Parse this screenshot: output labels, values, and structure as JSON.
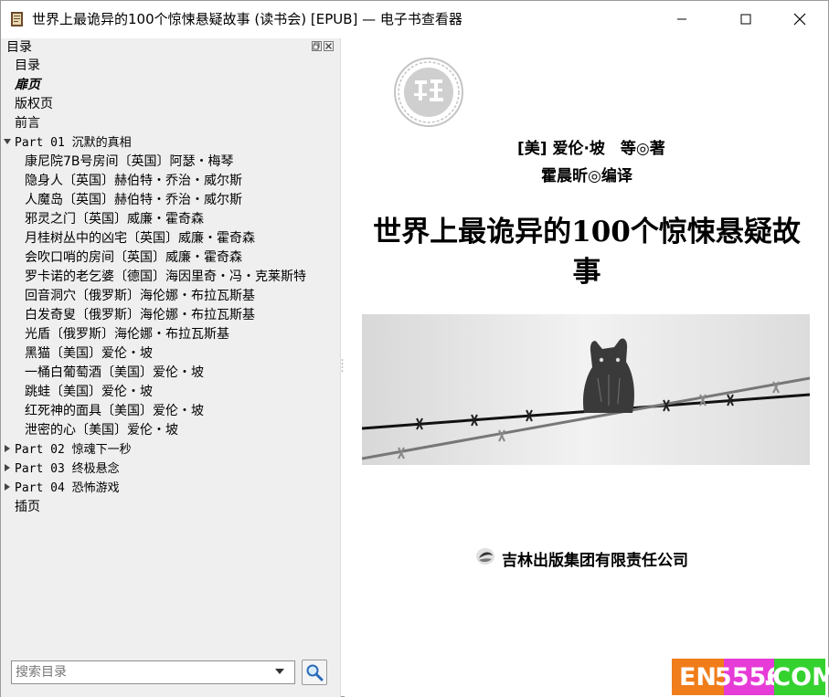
{
  "window": {
    "title": "世界上最诡异的100个惊悚悬疑故事 (读书会) [EPUB] — 电子书查看器"
  },
  "sidebar": {
    "dock_title": "目录",
    "toc": [
      {
        "label": "目录",
        "level": 0
      },
      {
        "label": "扉页",
        "level": 0,
        "style": "italic-bold"
      },
      {
        "label": "版权页",
        "level": 0
      },
      {
        "label": "前言",
        "level": 0
      },
      {
        "label": "Part 01 沉默的真相",
        "level": 0,
        "expanded": true
      },
      {
        "label": "康尼院7B号房间〔英国〕阿瑟・梅琴",
        "level": 1
      },
      {
        "label": "隐身人〔英国〕赫伯特・乔治・威尔斯",
        "level": 1
      },
      {
        "label": "人魔岛〔英国〕赫伯特・乔治・威尔斯",
        "level": 1
      },
      {
        "label": "邪灵之门〔英国〕威廉・霍奇森",
        "level": 1
      },
      {
        "label": "月桂树丛中的凶宅〔英国〕威廉・霍奇森",
        "level": 1
      },
      {
        "label": "会吹口哨的房间〔英国〕威廉・霍奇森",
        "level": 1
      },
      {
        "label": "罗卡诺的老乞婆〔德国〕海因里奇・冯・克莱斯特",
        "level": 1
      },
      {
        "label": "回音洞穴〔俄罗斯〕海伦娜・布拉瓦斯基",
        "level": 1
      },
      {
        "label": "白发奇叟〔俄罗斯〕海伦娜・布拉瓦斯基",
        "level": 1
      },
      {
        "label": "光盾〔俄罗斯〕海伦娜・布拉瓦斯基",
        "level": 1
      },
      {
        "label": "黑猫〔美国〕爱伦・坡",
        "level": 1
      },
      {
        "label": "一桶白葡萄酒〔美国〕爱伦・坡",
        "level": 1
      },
      {
        "label": "跳蛙〔美国〕爱伦・坡",
        "level": 1
      },
      {
        "label": "红死神的面具〔美国〕爱伦・坡",
        "level": 1
      },
      {
        "label": "泄密的心〔美国〕爱伦・坡",
        "level": 1
      },
      {
        "label": "Part 02 惊魂下一秒",
        "level": 0,
        "expanded": false
      },
      {
        "label": "Part 03 终极悬念",
        "level": 0,
        "expanded": false
      },
      {
        "label": "Part 04 恐怖游戏",
        "level": 0,
        "expanded": false
      },
      {
        "label": "插页",
        "level": 0
      }
    ],
    "search": {
      "placeholder": "搜索目录",
      "value": ""
    }
  },
  "page": {
    "author": "[美] 爱伦·坡　等◎著",
    "translator": "霍晨昕◎编译",
    "book_title": "世界上最诡异的100个惊悚悬疑故事",
    "publisher": "吉林出版集团有限责任公司"
  },
  "watermark": {
    "part1": "EN",
    "part2": "5556",
    "part3": ".COM"
  },
  "colors": {
    "sidebar_bg": "#efefef",
    "watermark_orange": "#f07d1a",
    "watermark_magenta": "#e63bd6",
    "watermark_green": "#35d22f"
  }
}
